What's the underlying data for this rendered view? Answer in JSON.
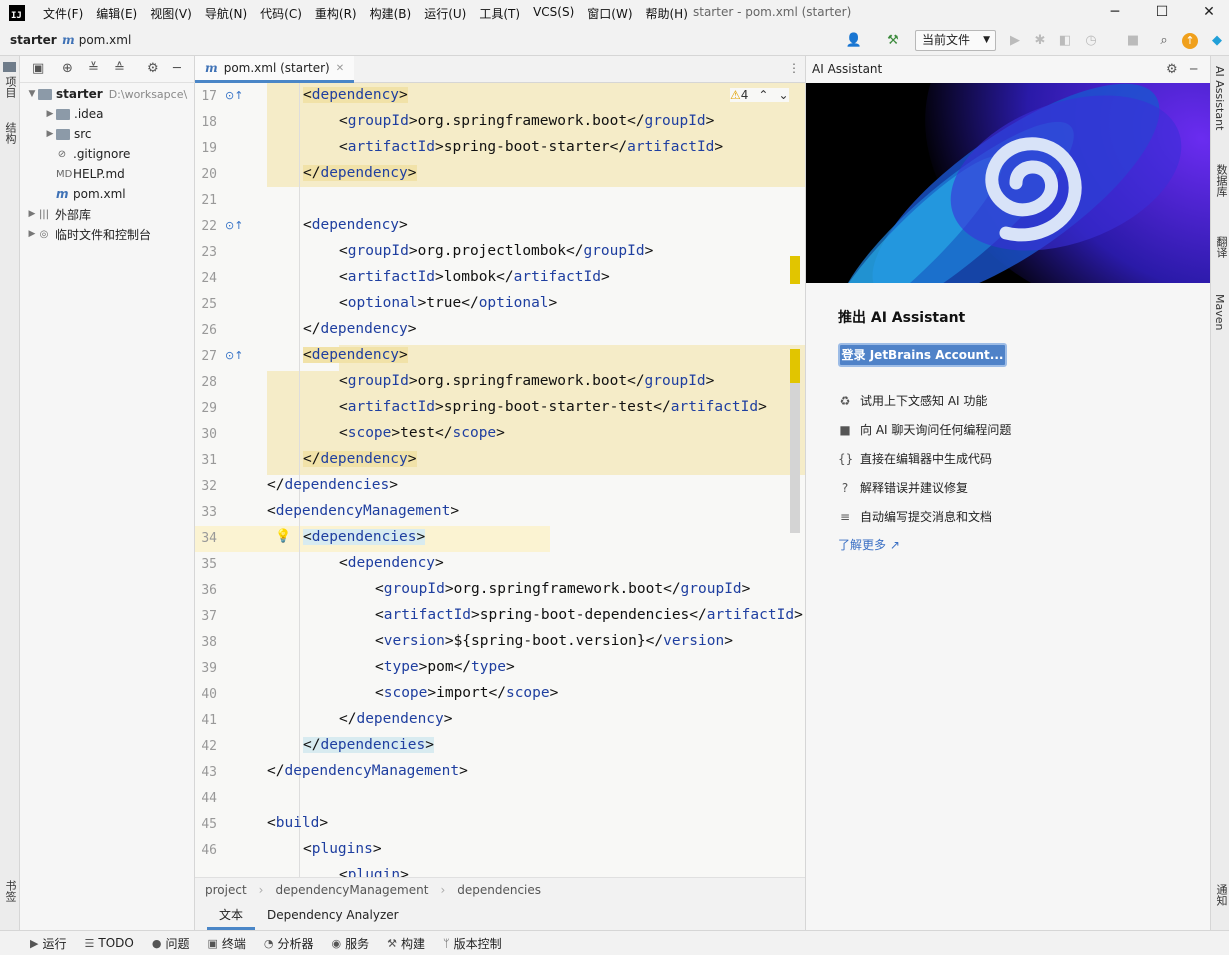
{
  "menu": {
    "logo": "IJ",
    "items": [
      "文件(F)",
      "编辑(E)",
      "视图(V)",
      "导航(N)",
      "代码(C)",
      "重构(R)",
      "构建(B)",
      "运行(U)",
      "工具(T)",
      "VCS(S)",
      "窗口(W)",
      "帮助(H)"
    ],
    "window_title": "starter - pom.xml (starter)"
  },
  "navbar": {
    "project": "starter",
    "file": "pom.xml",
    "run_config": "当前文件"
  },
  "left_stripe": {
    "project_tab": "项目",
    "structure_tab": "结构",
    "bookmarks_tab": "书签"
  },
  "right_stripe": {
    "ai_tab": "AI Assistant",
    "db_tab": "数据库",
    "notify_tab": "通知",
    "maven_tab": "Maven",
    "other_tab": "翻译"
  },
  "project_tree": {
    "rows": [
      {
        "label": "starter",
        "path": "D:\\worksapce\\",
        "indent": 0,
        "expanded": true,
        "type": "folder",
        "bold": true
      },
      {
        "label": ".idea",
        "indent": 1,
        "expanded": false,
        "type": "folder"
      },
      {
        "label": "src",
        "indent": 1,
        "expanded": false,
        "type": "folder"
      },
      {
        "label": ".gitignore",
        "indent": 1,
        "type": "file",
        "icon": "⊘"
      },
      {
        "label": "HELP.md",
        "indent": 1,
        "type": "file",
        "icon": "MD"
      },
      {
        "label": "pom.xml",
        "indent": 1,
        "type": "file",
        "icon": "m"
      },
      {
        "label": "外部库",
        "indent": 0,
        "expanded": false,
        "type": "lib"
      },
      {
        "label": "临时文件和控制台",
        "indent": 0,
        "expanded": false,
        "type": "scratch"
      }
    ]
  },
  "editor": {
    "tab_label": "pom.xml (starter)",
    "warning_count": "4",
    "lines": [
      {
        "n": "17",
        "i": 1,
        "parts": [
          [
            "t",
            "<"
          ],
          [
            "n",
            "dependency"
          ],
          [
            "t",
            ">"
          ]
        ]
      },
      {
        "n": "18",
        "i": 2,
        "parts": [
          [
            "t",
            "<"
          ],
          [
            "n",
            "groupId"
          ],
          [
            "t",
            ">org.springframework.boot</"
          ],
          [
            "n",
            "groupId"
          ],
          [
            "t",
            ">"
          ]
        ]
      },
      {
        "n": "19",
        "i": 2,
        "parts": [
          [
            "t",
            "<"
          ],
          [
            "n",
            "artifactId"
          ],
          [
            "t",
            ">spring-boot-starter</"
          ],
          [
            "n",
            "artifactId"
          ],
          [
            "t",
            ">"
          ]
        ]
      },
      {
        "n": "20",
        "i": 1,
        "parts": [
          [
            "t",
            "</"
          ],
          [
            "n",
            "dependency"
          ],
          [
            "t",
            ">"
          ]
        ]
      },
      {
        "n": "21",
        "i": 0,
        "parts": []
      },
      {
        "n": "22",
        "i": 1,
        "parts": [
          [
            "t",
            "<"
          ],
          [
            "n",
            "dependency"
          ],
          [
            "t",
            ">"
          ]
        ]
      },
      {
        "n": "23",
        "i": 2,
        "parts": [
          [
            "t",
            "<"
          ],
          [
            "n",
            "groupId"
          ],
          [
            "t",
            ">org.projectlombok</"
          ],
          [
            "n",
            "groupId"
          ],
          [
            "t",
            ">"
          ]
        ]
      },
      {
        "n": "24",
        "i": 2,
        "parts": [
          [
            "t",
            "<"
          ],
          [
            "n",
            "artifactId"
          ],
          [
            "t",
            ">lombok</"
          ],
          [
            "n",
            "artifactId"
          ],
          [
            "t",
            ">"
          ]
        ]
      },
      {
        "n": "25",
        "i": 2,
        "parts": [
          [
            "t",
            "<"
          ],
          [
            "n",
            "optional"
          ],
          [
            "t",
            ">true</"
          ],
          [
            "n",
            "optional"
          ],
          [
            "t",
            ">"
          ]
        ]
      },
      {
        "n": "26",
        "i": 1,
        "parts": [
          [
            "t",
            "</"
          ],
          [
            "n",
            "dependency"
          ],
          [
            "t",
            ">"
          ]
        ]
      },
      {
        "n": "27",
        "i": 1,
        "parts": [
          [
            "t",
            "<"
          ],
          [
            "n",
            "dependency"
          ],
          [
            "t",
            ">"
          ]
        ]
      },
      {
        "n": "28",
        "i": 2,
        "parts": [
          [
            "t",
            "<"
          ],
          [
            "n",
            "groupId"
          ],
          [
            "t",
            ">org.springframework.boot</"
          ],
          [
            "n",
            "groupId"
          ],
          [
            "t",
            ">"
          ]
        ]
      },
      {
        "n": "29",
        "i": 2,
        "parts": [
          [
            "t",
            "<"
          ],
          [
            "n",
            "artifactId"
          ],
          [
            "t",
            ">spring-boot-starter-test</"
          ],
          [
            "n",
            "artifactId"
          ],
          [
            "t",
            ">"
          ]
        ]
      },
      {
        "n": "30",
        "i": 2,
        "parts": [
          [
            "t",
            "<"
          ],
          [
            "n",
            "scope"
          ],
          [
            "t",
            ">test</"
          ],
          [
            "n",
            "scope"
          ],
          [
            "t",
            ">"
          ]
        ]
      },
      {
        "n": "31",
        "i": 1,
        "parts": [
          [
            "t",
            "</"
          ],
          [
            "n",
            "dependency"
          ],
          [
            "t",
            ">"
          ]
        ]
      },
      {
        "n": "32",
        "i": 0,
        "parts": [
          [
            "t",
            "</"
          ],
          [
            "n",
            "dependencies"
          ],
          [
            "t",
            ">"
          ]
        ]
      },
      {
        "n": "33",
        "i": 0,
        "parts": [
          [
            "t",
            "<"
          ],
          [
            "n",
            "dependencyManagement"
          ],
          [
            "t",
            ">"
          ]
        ]
      },
      {
        "n": "34",
        "i": 1,
        "parts": [
          [
            "t",
            "<"
          ],
          [
            "n",
            "dependencies"
          ],
          [
            "t",
            ">"
          ]
        ]
      },
      {
        "n": "35",
        "i": 2,
        "parts": [
          [
            "t",
            "<"
          ],
          [
            "n",
            "dependency"
          ],
          [
            "t",
            ">"
          ]
        ]
      },
      {
        "n": "36",
        "i": 3,
        "parts": [
          [
            "t",
            "<"
          ],
          [
            "n",
            "groupId"
          ],
          [
            "t",
            ">org.springframework.boot</"
          ],
          [
            "n",
            "groupId"
          ],
          [
            "t",
            ">"
          ]
        ]
      },
      {
        "n": "37",
        "i": 3,
        "parts": [
          [
            "t",
            "<"
          ],
          [
            "n",
            "artifactId"
          ],
          [
            "t",
            ">spring-boot-dependencies</"
          ],
          [
            "n",
            "artifactId"
          ],
          [
            "t",
            ">"
          ]
        ]
      },
      {
        "n": "38",
        "i": 3,
        "parts": [
          [
            "t",
            "<"
          ],
          [
            "n",
            "version"
          ],
          [
            "t",
            ">${spring-boot.version}</"
          ],
          [
            "n",
            "version"
          ],
          [
            "t",
            ">"
          ]
        ]
      },
      {
        "n": "39",
        "i": 3,
        "parts": [
          [
            "t",
            "<"
          ],
          [
            "n",
            "type"
          ],
          [
            "t",
            ">pom</"
          ],
          [
            "n",
            "type"
          ],
          [
            "t",
            ">"
          ]
        ]
      },
      {
        "n": "40",
        "i": 3,
        "parts": [
          [
            "t",
            "<"
          ],
          [
            "n",
            "scope"
          ],
          [
            "t",
            ">import</"
          ],
          [
            "n",
            "scope"
          ],
          [
            "t",
            ">"
          ]
        ]
      },
      {
        "n": "41",
        "i": 2,
        "parts": [
          [
            "t",
            "</"
          ],
          [
            "n",
            "dependency"
          ],
          [
            "t",
            ">"
          ]
        ]
      },
      {
        "n": "42",
        "i": 1,
        "parts": [
          [
            "t",
            "</"
          ],
          [
            "n",
            "dependencies"
          ],
          [
            "t",
            ">"
          ]
        ]
      },
      {
        "n": "43",
        "i": 0,
        "parts": [
          [
            "t",
            "</"
          ],
          [
            "n",
            "dependencyManagement"
          ],
          [
            "t",
            ">"
          ]
        ]
      },
      {
        "n": "44",
        "i": 0,
        "parts": []
      },
      {
        "n": "45",
        "i": 0,
        "parts": [
          [
            "t",
            "<"
          ],
          [
            "n",
            "build"
          ],
          [
            "t",
            ">"
          ]
        ]
      },
      {
        "n": "46",
        "i": 1,
        "parts": [
          [
            "t",
            "<"
          ],
          [
            "n",
            "plugins"
          ],
          [
            "t",
            ">"
          ]
        ]
      },
      {
        "n": "",
        "i": 2,
        "parts": [
          [
            "t",
            "<"
          ],
          [
            "n",
            "plugin"
          ],
          [
            "t",
            ">"
          ]
        ]
      }
    ],
    "breadcrumb": [
      "project",
      "dependencyManagement",
      "dependencies"
    ],
    "bottom_tabs": [
      "文本",
      "Dependency Analyzer"
    ]
  },
  "ai": {
    "header": "AI Assistant",
    "title": "推出 AI Assistant",
    "login_button": "登录 JetBrains Account...",
    "features": [
      {
        "icon": "♻",
        "label": "试用上下文感知 AI 功能"
      },
      {
        "icon": "■",
        "label": "向 AI 聊天询问任何编程问题"
      },
      {
        "icon": "{}",
        "label": "直接在编辑器中生成代码"
      },
      {
        "icon": "?",
        "label": "解释错误并建议修复"
      },
      {
        "icon": "≡",
        "label": "自动编写提交消息和文档"
      }
    ],
    "learn_more": "了解更多 ↗"
  },
  "statusbar": {
    "items": [
      {
        "icon": "▶",
        "label": "运行"
      },
      {
        "icon": "☰",
        "label": "TODO"
      },
      {
        "icon": "●",
        "label": "问题"
      },
      {
        "icon": "▣",
        "label": "终端"
      },
      {
        "icon": "◔",
        "label": "分析器"
      },
      {
        "icon": "◉",
        "label": "服务"
      },
      {
        "icon": "⚒",
        "label": "构建"
      },
      {
        "icon": "ᛘ",
        "label": "版本控制"
      }
    ]
  }
}
